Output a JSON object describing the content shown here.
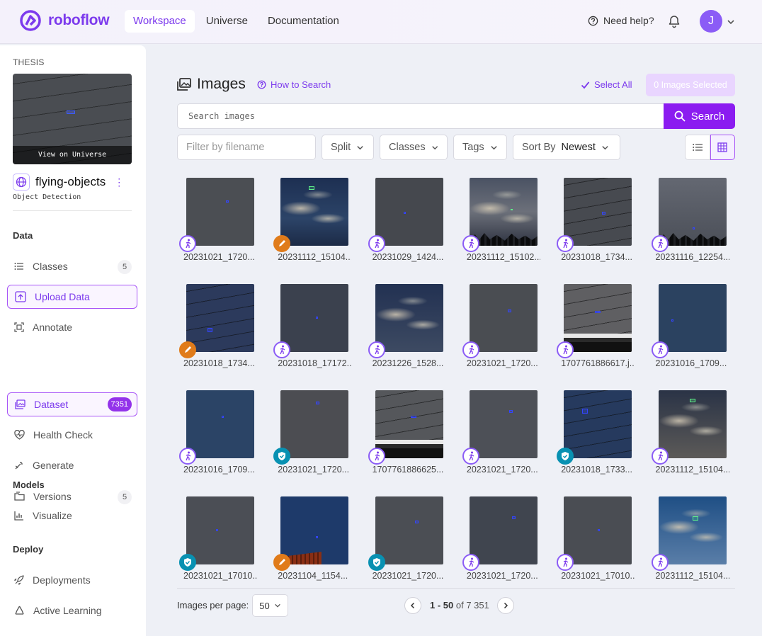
{
  "brand": {
    "name": "roboflow",
    "accent": "#7c3aed"
  },
  "nav": {
    "tabs": [
      "Workspace",
      "Universe",
      "Documentation"
    ],
    "active": "Workspace",
    "help": "Need help?",
    "user_initial": "J"
  },
  "sidebar": {
    "workspace_label": "THESIS",
    "view_on_universe": "View on Universe",
    "project_name": "flying-objects",
    "project_type": "Object Detection",
    "sections": {
      "data": "Data",
      "models": "Models",
      "deploy": "Deploy"
    },
    "items": [
      {
        "label": "Classes",
        "icon": "list-icon",
        "badge": "5"
      },
      {
        "label": "Upload Data",
        "icon": "upload-icon"
      },
      {
        "label": "Annotate",
        "icon": "annotate-icon"
      },
      {
        "label": "Dataset",
        "icon": "images-icon",
        "badge": "7351"
      },
      {
        "label": "Health Check",
        "icon": "heart-icon"
      },
      {
        "label": "Generate",
        "icon": "generate-icon"
      },
      {
        "label": "Versions",
        "icon": "versions-icon",
        "badge": "5"
      },
      {
        "label": "Visualize",
        "icon": "chart-icon"
      },
      {
        "label": "Deployments",
        "icon": "rocket-icon"
      },
      {
        "label": "Active Learning",
        "icon": "recycle-icon"
      }
    ]
  },
  "main": {
    "title": "Images",
    "how_to_search": "How to Search",
    "select_all": "Select All",
    "selected_count": "0 Images Selected",
    "search": {
      "placeholder": "Search images",
      "button": "Search"
    },
    "filters": {
      "filename_placeholder": "Filter by filename",
      "split": "Split",
      "classes": "Classes",
      "tags": "Tags",
      "sort_label": "Sort By",
      "sort_value": "Newest"
    },
    "images": [
      {
        "name": "20231021_1720...",
        "status": "unassigned"
      },
      {
        "name": "20231112_15104...",
        "status": "annotating"
      },
      {
        "name": "20231029_1424...",
        "status": "unassigned"
      },
      {
        "name": "20231112_15102...",
        "status": "unassigned"
      },
      {
        "name": "20231018_1734...",
        "status": "unassigned"
      },
      {
        "name": "20231116_12254...",
        "status": "unassigned"
      },
      {
        "name": "20231018_1734...",
        "status": "annotating"
      },
      {
        "name": "20231018_17172...",
        "status": "unassigned"
      },
      {
        "name": "20231226_1528...",
        "status": "unassigned"
      },
      {
        "name": "20231021_1720...",
        "status": "unassigned"
      },
      {
        "name": "1707761886617.j...",
        "status": "unassigned"
      },
      {
        "name": "20231016_1709...",
        "status": "unassigned"
      },
      {
        "name": "20231016_1709...",
        "status": "unassigned"
      },
      {
        "name": "20231021_1720...",
        "status": "approved"
      },
      {
        "name": "1707761886625...",
        "status": "unassigned"
      },
      {
        "name": "20231021_1720...",
        "status": "unassigned"
      },
      {
        "name": "20231018_1733...",
        "status": "approved"
      },
      {
        "name": "20231112_15104...",
        "status": "unassigned"
      },
      {
        "name": "20231021_17010...",
        "status": "approved"
      },
      {
        "name": "20231104_1154...",
        "status": "annotating"
      },
      {
        "name": "20231021_1720...",
        "status": "approved"
      },
      {
        "name": "20231021_1720...",
        "status": "unassigned"
      },
      {
        "name": "20231021_17010...",
        "status": "unassigned"
      },
      {
        "name": "20231112_15104...",
        "status": "unassigned"
      }
    ],
    "pagination": {
      "per_page_label": "Images per page:",
      "per_page": "50",
      "range": "1 - 50",
      "of_label": "of 7 351"
    }
  }
}
